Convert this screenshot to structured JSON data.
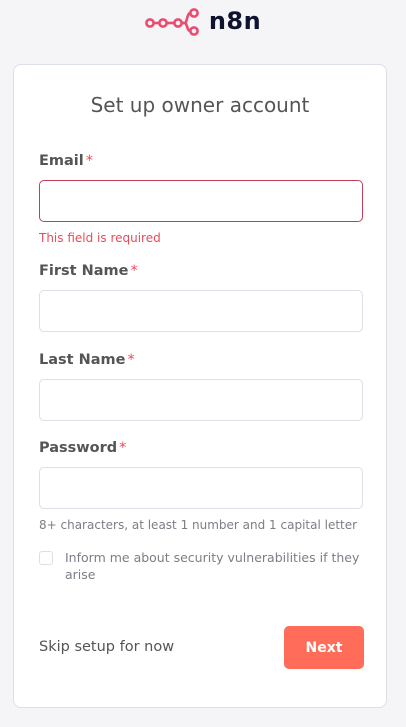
{
  "logo": {
    "text": "n8n",
    "icon": "n8n-logo-icon",
    "color": "#ea4b71"
  },
  "form": {
    "title": "Set up owner account",
    "required_marker": "*",
    "email": {
      "label": "Email",
      "value": "",
      "error": "This field is required"
    },
    "first_name": {
      "label": "First Name",
      "value": ""
    },
    "last_name": {
      "label": "Last Name",
      "value": ""
    },
    "password": {
      "label": "Password",
      "value": "",
      "hint": "8+ characters, at least 1 number and 1 capital letter"
    },
    "security_updates": {
      "label": "Inform me about security vulnerabilities if they arise",
      "checked": false
    },
    "skip_label": "Skip setup for now",
    "next_label": "Next"
  },
  "colors": {
    "accent": "#ff6d5a",
    "error": "#ea4b5a",
    "logo_pink": "#ea4b71",
    "logo_text": "#101330"
  }
}
